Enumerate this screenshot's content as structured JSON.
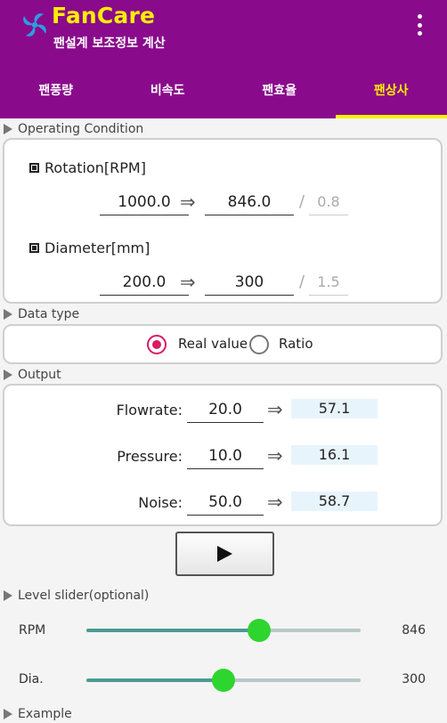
{
  "app": {
    "title": "FanCare",
    "subtitle": "팬설계 보조정보 계산",
    "accent": "#ffee00",
    "brand": "#8a0a8c"
  },
  "tabs": [
    {
      "label": "팬풍량",
      "active": false
    },
    {
      "label": "비속도",
      "active": false
    },
    {
      "label": "팬효율",
      "active": false
    },
    {
      "label": "팬상사",
      "active": true
    }
  ],
  "operating": {
    "section_title": "Operating Condition",
    "rotation": {
      "label": "Rotation[RPM]",
      "from": "1000.0",
      "to": "846.0",
      "ratio": "0.8"
    },
    "diameter": {
      "label": "Diameter[mm]",
      "from": "200.0",
      "to": "300",
      "ratio": "1.5"
    }
  },
  "datatype": {
    "section_title": "Data type",
    "options": [
      {
        "label": "Real value",
        "selected": true
      },
      {
        "label": "Ratio",
        "selected": false
      }
    ]
  },
  "output": {
    "section_title": "Output",
    "rows": [
      {
        "label": "Flowrate:",
        "input": "20.0",
        "result": "57.1"
      },
      {
        "label": "Pressure:",
        "input": "10.0",
        "result": "16.1"
      },
      {
        "label": "Noise:",
        "input": "50.0",
        "result": "58.7"
      }
    ]
  },
  "level_slider": {
    "section_title": "Level slider(optional)",
    "rpm": {
      "label": "RPM",
      "value": "846",
      "level": 0.63
    },
    "dia": {
      "label": "Dia.",
      "value": "300",
      "level": 0.5
    }
  },
  "footer_partial": "Example"
}
